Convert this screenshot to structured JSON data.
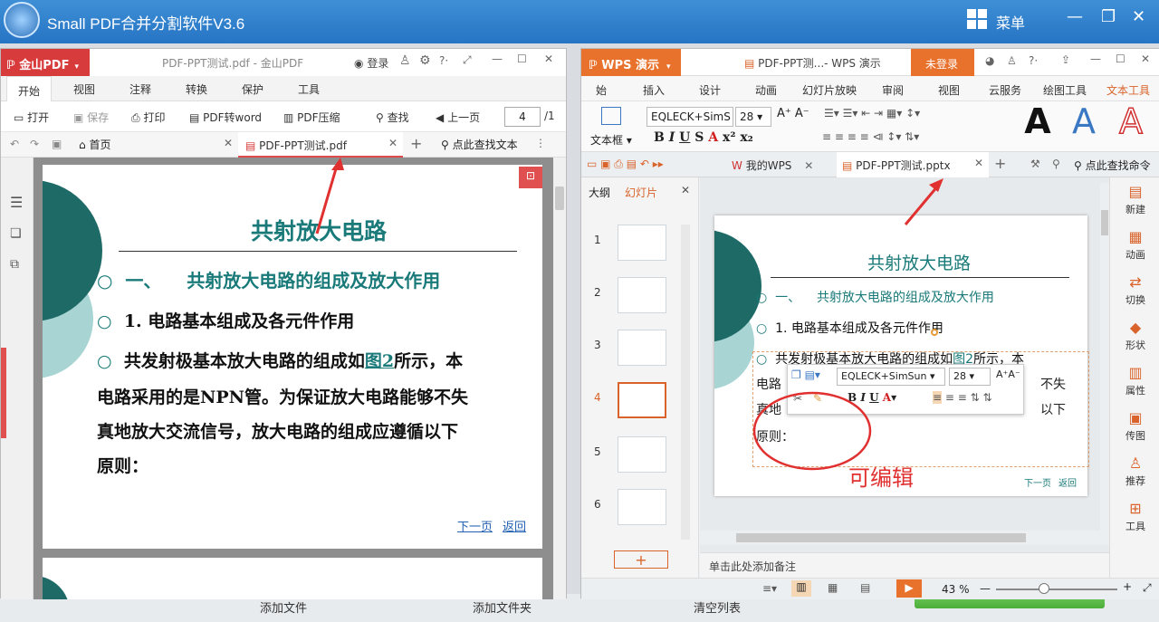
{
  "outer": {
    "title": "Small  PDF合并分割软件V3.6",
    "menu_label": "菜单",
    "bottom_buttons": [
      "添加文件",
      "添加文件夹",
      "清空列表"
    ]
  },
  "left_window": {
    "brand": "金山PDF",
    "doc_title": "PDF-PPT测试.pdf - 金山PDF",
    "login": "登录",
    "tabs": [
      "开始",
      "视图",
      "注释",
      "转换",
      "保护",
      "工具"
    ],
    "toolbar": {
      "open": "打开",
      "save": "保存",
      "print": "打印",
      "to_word": "PDF转word",
      "compress": "PDF压缩",
      "find": "查找",
      "prev": "上一页",
      "page_value": "4",
      "page_total": "/1"
    },
    "home_tab": "首页",
    "doc_tab": "PDF-PPT测试.pdf",
    "search_text": "点此查找文本",
    "page": {
      "title": "共射放大电路",
      "line1_num": "一、",
      "line1_text": "共射放大电路的组成及放大作用",
      "line2": "1. 电路基本组成及各元件作用",
      "para_a": "共发射极基本放大电路的组成如",
      "para_link": "图2",
      "para_b": "所示，本",
      "para_line2": "电路采用的是NPN管。为保证放大电路能够不失",
      "para_line3": "真地放大交流信号，放大电路的组成应遵循以下",
      "para_line4": "原则：",
      "next": "下一页",
      "back": "返回"
    }
  },
  "right_window": {
    "brand": "WPS 演示",
    "doc_title": "PDF-PPT测...- WPS 演示",
    "login": "未登录",
    "tabs": [
      "始",
      "插入",
      "设计",
      "动画",
      "幻灯片放映",
      "审阅",
      "视图",
      "云服务",
      "绘图工具",
      "文本工具"
    ],
    "ribbon": {
      "textbox": "文本框",
      "font": "EQLECK+SimS",
      "size": "28"
    },
    "my_wps": "我的WPS",
    "doc_tab": "PDF-PPT测试.pptx",
    "search_cmd": "点此查找命令",
    "panel_tabs": [
      "大纲",
      "幻灯片"
    ],
    "slide_numbers": [
      "1",
      "2",
      "3",
      "4",
      "5",
      "6"
    ],
    "selected_slide": 4,
    "slide": {
      "title": "共射放大电路",
      "line1_num": "一、",
      "line1_text": "共射放大电路的组成及放大作用",
      "line2": "1. 电路基本组成及各元件作用",
      "para_a": "共发射极基本放大电路的组成如",
      "para_link": "图2",
      "para_b": "所示，本",
      "frag_r1": "不失",
      "frag_l1": "电路",
      "frag_l2": "真地",
      "frag_r2": "以下",
      "para_line4": "原则：",
      "next": "下一页",
      "back": "返回"
    },
    "floatbar": {
      "font": "EQLECK+SimSun",
      "size": "28"
    },
    "notes": "单击此处添加备注",
    "zoom": "43 %",
    "zoom_level": 0.43,
    "side_tools": [
      "新建",
      "动画",
      "切换",
      "形状",
      "属性",
      "传图",
      "推荐",
      "工具"
    ]
  },
  "annotation": "可编辑",
  "colors": {
    "kingsoft_red": "#d83b3b",
    "wps_orange": "#e8712c",
    "teal": "#1a7a7a",
    "annotation_red": "#e03030"
  }
}
